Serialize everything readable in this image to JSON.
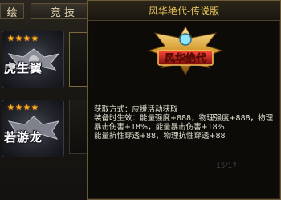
{
  "tabs": [
    {
      "label": "绘"
    },
    {
      "label": "竞 技"
    }
  ],
  "cards": [
    {
      "title": "虎生翼",
      "stars": "★★★★"
    },
    {
      "title": "若游龙",
      "stars": "★★★★"
    }
  ],
  "tooltip": {
    "title": "风华绝代-传说版",
    "icon_text": "风华绝代",
    "lines": [
      "获取方式：应援活动获取",
      "装备时生效：能量强度+888，物理强度+888，物理暴击伤害+18%，能量暴击伤害+18%",
      "能量抗性穿透+88，物理抗性穿透+88"
    ]
  },
  "pager": {
    "text": "15/17"
  },
  "colors": {
    "title": "#e8c35a",
    "border": "#6b5a37",
    "star": "#ffb52a"
  }
}
